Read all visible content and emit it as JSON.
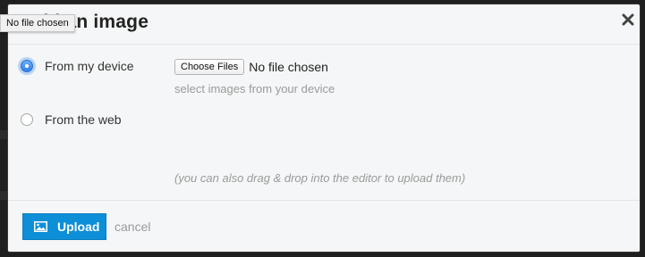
{
  "dialog": {
    "title": "Add an image",
    "close_icon": "close-x-icon"
  },
  "tooltip": {
    "text": "No file chosen"
  },
  "options": [
    {
      "label": "From my device",
      "checked": true
    },
    {
      "label": "From the web",
      "checked": false
    }
  ],
  "file_input": {
    "button_label": "Choose Files",
    "status": "No file chosen",
    "hint": "select images from your device"
  },
  "drag_hint": "(you can also drag & drop into the editor to upload them)",
  "footer": {
    "upload_label": "Upload",
    "upload_icon": "image-icon",
    "cancel_label": "cancel"
  },
  "colors": {
    "accent": "#0d8fd8",
    "dialog_bg": "#f5f6f7",
    "muted_text": "#9a9a9a"
  }
}
